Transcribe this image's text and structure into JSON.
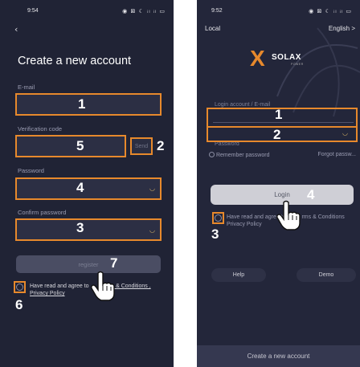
{
  "left_screen": {
    "status_time": "9:54",
    "status_icons": "◉ ⊠ ☾ ᵢₗ ᵢₗ ▭",
    "back_icon": "‹",
    "title": "Create a new account",
    "email_label": "E-mail",
    "verification_label": "Verification code",
    "send_label": "Send",
    "password_label": "Password",
    "confirm_password_label": "Confirm password",
    "register_label": "register",
    "agree_text": "Have read and agree to",
    "terms_text": "rms & Conditions ,",
    "privacy_text": "Privacy Policy",
    "annotations": [
      "1",
      "2",
      "3",
      "4",
      "5",
      "7",
      "6"
    ]
  },
  "right_screen": {
    "status_time": "9:52",
    "status_icons": "◉ ⊠ ☾ ᵢₗ ᵢₗ ▭",
    "local_label": "Local",
    "language_label": "English >",
    "logo_text": "SOLAX",
    "logo_sub": "POWER",
    "login_label": "Login account / E-mail",
    "password_label": "Password",
    "remember_label": "Remember password",
    "forgot_label": "Forgot passw...",
    "login_button": "Login",
    "agree_text": "Have read and agree to",
    "terms_text": "rms & Conditions",
    "privacy_text": "Privacy Policy",
    "help_label": "Help",
    "demo_label": "Demo",
    "create_account_label": "Create a new account",
    "annotations": [
      "1",
      "2",
      "4",
      "3"
    ]
  },
  "colors": {
    "background": "#202335",
    "field": "#2c2f44",
    "highlight_box": "#e7892c",
    "accent": "#e7892c"
  }
}
